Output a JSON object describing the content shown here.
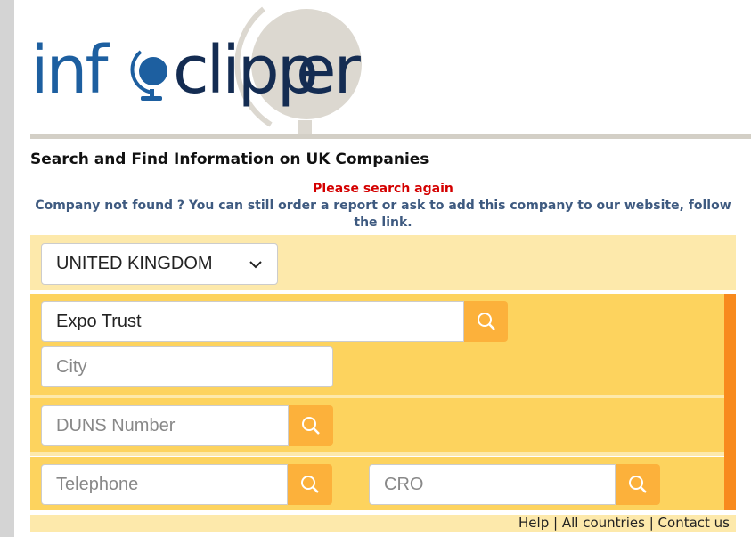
{
  "logo": {
    "text": "infoclipper",
    "colors": {
      "info": "#1d5fa0",
      "clipper": "#142c52",
      "globe_bg": "#dcd8d0"
    }
  },
  "heading": "Search and Find Information on UK Companies",
  "error": "Please search again",
  "message": "Company not found ? You can still order a report or ask to add this company to our website, follow the link.",
  "country_select": {
    "value": "UNITED KINGDOM",
    "icon": "chevron-down-icon"
  },
  "fields": {
    "company": {
      "value": "Expo Trust",
      "placeholder": ""
    },
    "city": {
      "value": "",
      "placeholder": "City"
    },
    "duns": {
      "value": "",
      "placeholder": "DUNS Number"
    },
    "telephone": {
      "value": "",
      "placeholder": "Telephone"
    },
    "cro": {
      "value": "",
      "placeholder": "CRO"
    }
  },
  "search_icon": "search-icon",
  "footer": {
    "help": "Help",
    "sep": "|",
    "all_countries": "All countries",
    "contact": "Contact us"
  },
  "colors": {
    "panel_light": "#fde9ab",
    "panel": "#fdd35e",
    "button": "#fcb13b",
    "accent": "#f88a1d",
    "error": "#d40000",
    "message": "#3e5a80"
  }
}
